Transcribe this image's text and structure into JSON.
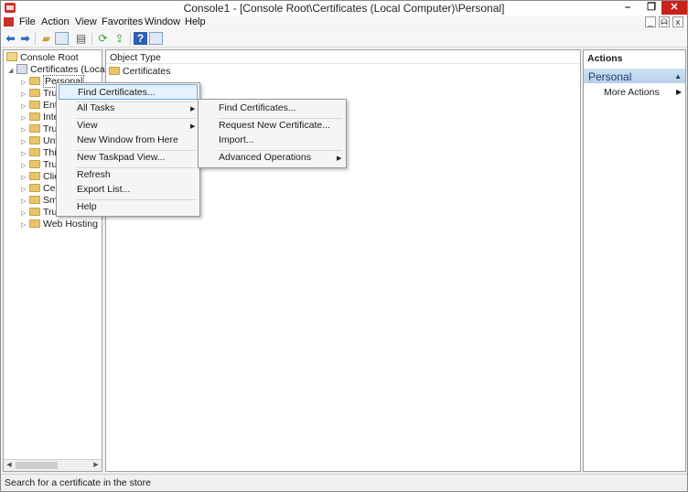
{
  "window": {
    "title": "Console1 - [Console Root\\Certificates (Local Computer)\\Personal]",
    "buttons": {
      "minimize": "–",
      "maximize": "❐",
      "close": "✕"
    }
  },
  "menubar": {
    "items": [
      "File",
      "Action",
      "View",
      "Favorites",
      "Window",
      "Help"
    ],
    "mdi_buttons": [
      "_",
      "ᗣ",
      "x"
    ]
  },
  "toolbar": {
    "icons": [
      "back-arrow-icon",
      "forward-arrow-icon",
      "up-folder-icon",
      "show-hide-tree-icon",
      "properties-icon",
      "refresh-icon",
      "export-list-icon",
      "help-icon",
      "show-action-pane-icon"
    ]
  },
  "tree": {
    "items": [
      {
        "label": "Console Root",
        "icon": "console-root-icon"
      },
      {
        "label": "Certificates (Local C",
        "icon": "certificates-icon"
      },
      {
        "label": "Personal",
        "icon": "folder-icon"
      },
      {
        "label": "Tru",
        "icon": "folder-icon"
      },
      {
        "label": "Ent",
        "icon": "folder-icon"
      },
      {
        "label": "Inte",
        "icon": "folder-icon"
      },
      {
        "label": "Tru",
        "icon": "folder-icon"
      },
      {
        "label": "Unt",
        "icon": "folder-icon"
      },
      {
        "label": "Thi",
        "icon": "folder-icon"
      },
      {
        "label": "Tru",
        "icon": "folder-icon"
      },
      {
        "label": "Clie",
        "icon": "folder-icon"
      },
      {
        "label": "Cer",
        "icon": "folder-icon"
      },
      {
        "label": "Sm",
        "icon": "folder-icon"
      },
      {
        "label": "Tru",
        "icon": "folder-icon"
      },
      {
        "label": "Web Hosting",
        "icon": "folder-icon"
      }
    ]
  },
  "list": {
    "column_header": "Object Type",
    "rows": [
      {
        "label": "Certificates",
        "icon": "folder-icon"
      }
    ]
  },
  "actions": {
    "title": "Actions",
    "section": "Personal",
    "items": [
      "More Actions"
    ]
  },
  "context_menu": {
    "items": [
      "Find Certificates...",
      "All Tasks",
      "View",
      "New Window from Here",
      "New Taskpad View...",
      "Refresh",
      "Export List...",
      "Help"
    ]
  },
  "submenu": {
    "items": [
      "Find Certificates...",
      "Request New Certificate...",
      "Import...",
      "Advanced Operations"
    ]
  },
  "statusbar": {
    "text": "Search for a certificate in the store"
  },
  "colors": {
    "close_button": "#c7221b",
    "highlight": "#e5f1fb",
    "actions_header": "#cfe1f3"
  }
}
